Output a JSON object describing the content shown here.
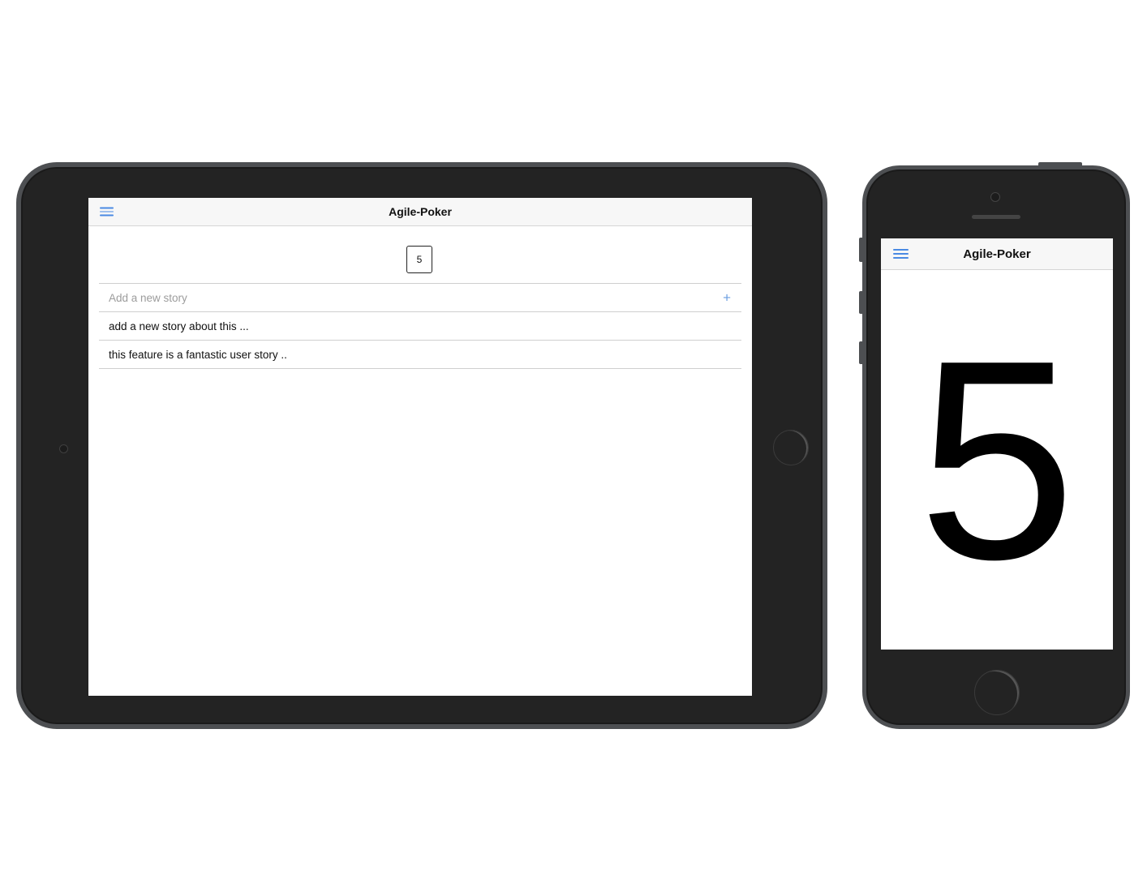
{
  "tablet": {
    "app_title": "Agile-Poker",
    "selected_card": "5",
    "new_story": {
      "placeholder": "Add a new story",
      "value": ""
    },
    "add_icon": "plus-icon",
    "stories": [
      "add a new story about this ...",
      "this feature is a fantastic user story .."
    ]
  },
  "phone": {
    "app_title": "Agile-Poker",
    "card_value": "5"
  },
  "colors": {
    "accent": "#4a8ae3",
    "navbar_bg": "#f7f7f7",
    "device_body": "#232323",
    "device_frame": "#4d4f52"
  },
  "icons": {
    "menu": "hamburger-menu-icon",
    "add": "plus-icon"
  }
}
